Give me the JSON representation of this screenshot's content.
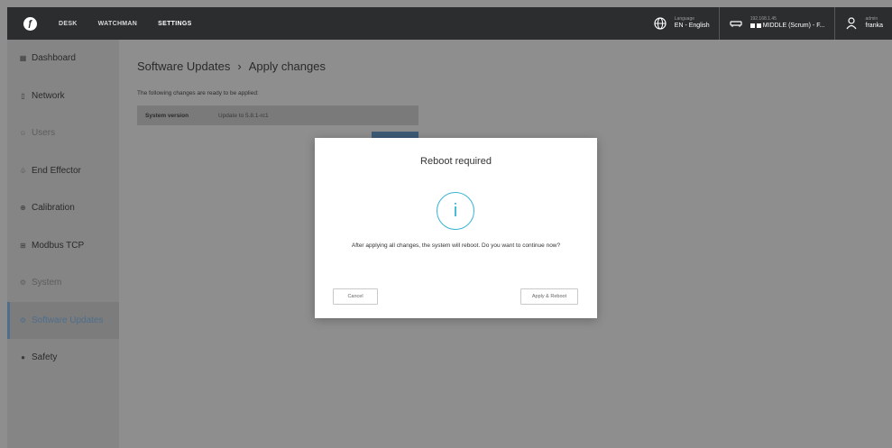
{
  "topbar": {
    "nav": [
      "DESK",
      "WATCHMAN",
      "SETTINGS"
    ],
    "language_label": "Language",
    "language_value": "EN - English",
    "ip": "192.168.1.45",
    "robot_status": "MIDDLE (Scrum) - F...",
    "user_role": "admin",
    "user_name": "franka"
  },
  "sidebar": {
    "items": [
      {
        "label": "Dashboard",
        "icon": "dashboard-icon"
      },
      {
        "label": "Network",
        "icon": "network-icon"
      },
      {
        "label": "Users",
        "icon": "users-icon"
      },
      {
        "label": "End Effector",
        "icon": "end-effector-icon"
      },
      {
        "label": "Calibration",
        "icon": "calibration-icon"
      },
      {
        "label": "Modbus TCP",
        "icon": "modbus-icon"
      },
      {
        "label": "System",
        "icon": "system-icon"
      },
      {
        "label": "Software Updates",
        "icon": "software-updates-icon"
      },
      {
        "label": "Safety",
        "icon": "safety-icon"
      }
    ]
  },
  "main": {
    "breadcrumb_section": "Software Updates",
    "breadcrumb_sep": "›",
    "breadcrumb_page": "Apply changes",
    "intro": "The following changes are ready to be applied:",
    "change_key": "System version",
    "change_value": "Update to 5.8.1-rc1"
  },
  "modal": {
    "title": "Reboot required",
    "icon_glyph": "i",
    "message": "After applying all changes, the system will reboot. Do you want to continue now?",
    "cancel_label": "Cancel",
    "apply_label": "Apply & Reboot"
  },
  "colors": {
    "accent": "#35b4d4",
    "active_nav": "#4e6e8c",
    "topbar": "#2b2d2f"
  }
}
